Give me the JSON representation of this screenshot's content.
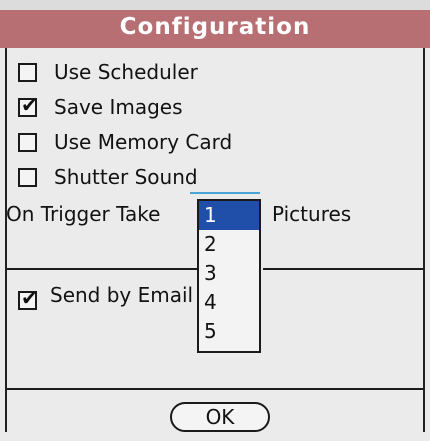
{
  "dialog": {
    "title": "Configuration",
    "options": [
      {
        "label": "Use Scheduler",
        "checked": false
      },
      {
        "label": "Save Images",
        "checked": true
      },
      {
        "label": "Use Memory Card",
        "checked": false
      },
      {
        "label": "Shutter Sound",
        "checked": false
      }
    ],
    "trigger": {
      "prefix": "On Trigger Take",
      "suffix": "Pictures",
      "selected": "1",
      "options": [
        "1",
        "2",
        "3",
        "4",
        "5"
      ]
    },
    "email": {
      "label": "Send by Email",
      "checked": true
    },
    "ok_label": "OK"
  }
}
